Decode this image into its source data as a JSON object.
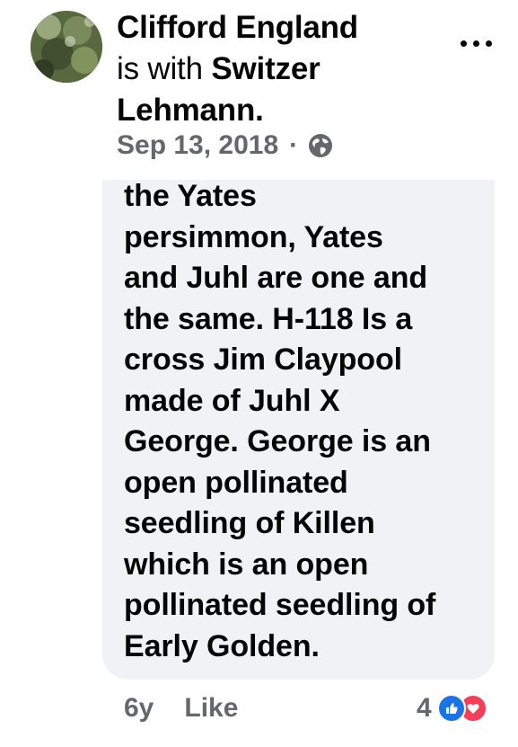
{
  "post": {
    "author": "Clifford England",
    "with_text": "is with",
    "tagged": "Switzer Lehmann.",
    "date": "Sep 13, 2018",
    "separator": "·",
    "privacy_icon": "globe-icon"
  },
  "comment": {
    "text": "the Yates\npersimmon, Yates\nand Juhl are one and\nthe same. H-118 Is a\ncross Jim Claypool\nmade of Juhl X\nGeorge. George is an\nopen pollinated\nseedling of Killen\nwhich is an open\npollinated seedling of\nEarly Golden."
  },
  "footer": {
    "age": "6y",
    "like_label": "Like",
    "reaction_count": "4",
    "reaction_icons": [
      "like-reaction-icon",
      "love-reaction-icon"
    ]
  },
  "colors": {
    "bubble": "#f0f2f5",
    "secondary_text": "#65676b",
    "like_blue": "#1b74e4",
    "love_red": "#f33e58"
  }
}
